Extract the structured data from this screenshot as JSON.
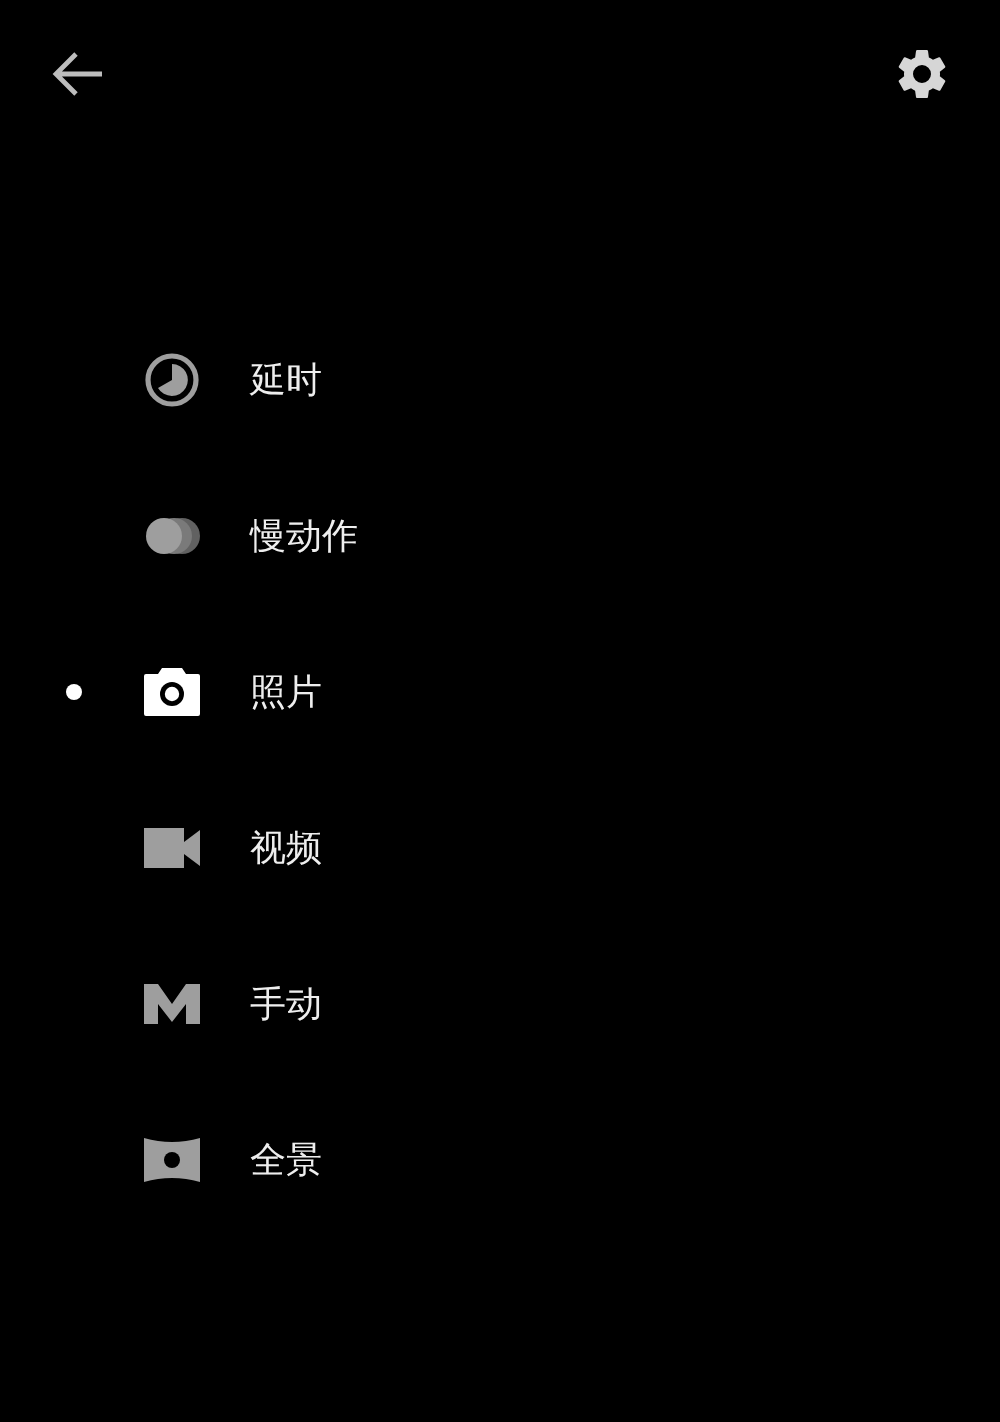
{
  "modes": [
    {
      "kind": "timelapse",
      "label": "延时",
      "selected": false
    },
    {
      "kind": "slowmo",
      "label": "慢动作",
      "selected": false
    },
    {
      "kind": "photo",
      "label": "照片",
      "selected": true
    },
    {
      "kind": "video",
      "label": "视频",
      "selected": false
    },
    {
      "kind": "manual",
      "label": "手动",
      "selected": false
    },
    {
      "kind": "panorama",
      "label": "全景",
      "selected": false
    }
  ]
}
